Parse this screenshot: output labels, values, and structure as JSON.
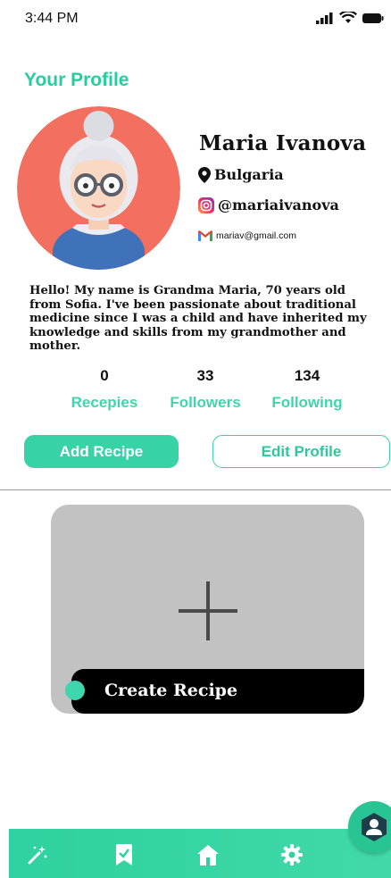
{
  "status_bar": {
    "time": "3:44 PM"
  },
  "page_title": "Your Profile",
  "profile": {
    "name": "Maria Ivanova",
    "location": "Bulgaria",
    "instagram": "@mariaivanova",
    "email": "mariav@gmail.com",
    "bio_lines": [
      "Hello! My name is Grandma Maria, 70 years old",
      "from Sofia. I've been passionate about traditional",
      "medicine since I was a child and have inherited my",
      "knowledge and skills from my grandmother and",
      "mother."
    ]
  },
  "stats": [
    {
      "value": "0",
      "label": "Recepies"
    },
    {
      "value": "33",
      "label": "Followers"
    },
    {
      "value": "134",
      "label": "Following"
    }
  ],
  "buttons": {
    "add_recipe": "Add Recipe",
    "edit_profile": "Edit Profile"
  },
  "create_card": {
    "label": "Create Recipe"
  },
  "nav": {
    "items": [
      {
        "icon": "magic-wand-icon"
      },
      {
        "icon": "bookmark-icon"
      },
      {
        "icon": "home-icon"
      },
      {
        "icon": "gear-icon"
      }
    ],
    "fab_icon": "profile-icon"
  },
  "colors": {
    "accent": "#27cd9f",
    "accent_light": "#3fd6ad",
    "card_bg": "#c2c2c2",
    "avatar_bg": "#f36f5f"
  }
}
